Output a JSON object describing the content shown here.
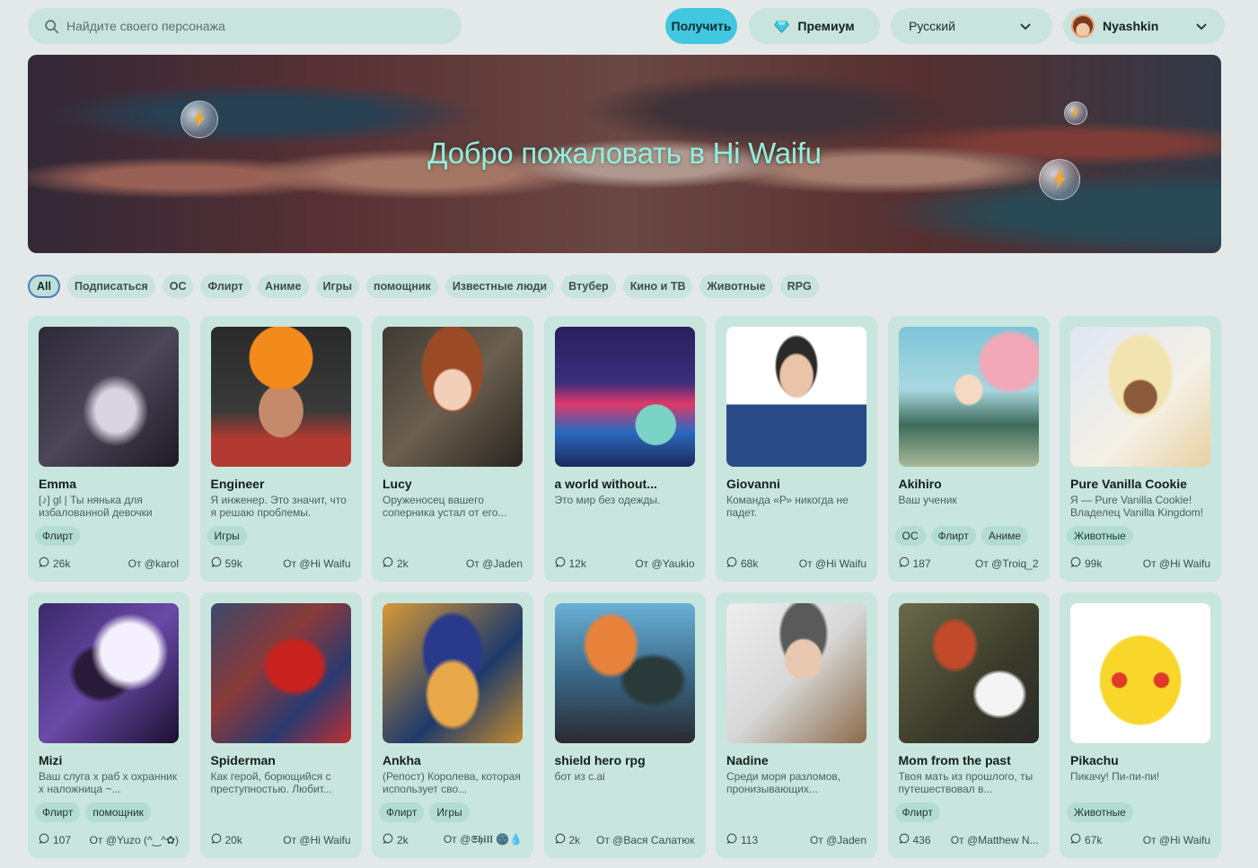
{
  "search": {
    "placeholder": "Найдите своего персонажа"
  },
  "header": {
    "get_label": "Получить",
    "premium_label": "Премиум",
    "language": "Русский",
    "username": "Nyashkin"
  },
  "banner": {
    "title": "Добро пожаловать в Hi Waifu"
  },
  "filters": [
    "All",
    "Подписаться",
    "OC",
    "Флирт",
    "Аниме",
    "Игры",
    "помощник",
    "Известные люди",
    "Втубер",
    "Кино и ТВ",
    "Животные",
    "RPG"
  ],
  "colors": {
    "accent": "#3fc8e0",
    "card": "#c8e6dd",
    "chip": "#c9e4dc",
    "title": "#8ff0dc"
  },
  "cards": [
    {
      "name": "Emma",
      "desc": "[♪] gl | Ты нянька для избалованной девочки",
      "tags": [
        "Флирт"
      ],
      "count": "26k",
      "author": "От @karol",
      "icon": "girl-phone-image"
    },
    {
      "name": "Engineer",
      "desc": "Я инженер. Это значит, что я решаю проблемы.",
      "tags": [
        "Игры"
      ],
      "count": "59k",
      "author": "От @Hi Waifu",
      "icon": "engineer-image"
    },
    {
      "name": "Lucy",
      "desc": "Оруженосец вашего соперника устал от его...",
      "tags": [],
      "count": "2k",
      "author": "От @Jaden",
      "icon": "lucy-image"
    },
    {
      "name": "a world without...",
      "desc": "Это мир без одежды.",
      "tags": [],
      "count": "12k",
      "author": "От @Yaukio",
      "icon": "un-mundo-image"
    },
    {
      "name": "Giovanni",
      "desc": "Команда «Р» никогда не падет.",
      "tags": [],
      "count": "68k",
      "author": "От @Hi Waifu",
      "icon": "giovanni-image"
    },
    {
      "name": "Akihiro",
      "desc": "Ваш ученик",
      "tags": [
        "OC",
        "Флирт",
        "Аниме"
      ],
      "count": "187",
      "author": "От @Troiq_2",
      "icon": "akihiro-image"
    },
    {
      "name": "Pure Vanilla Cookie",
      "desc": "Я — Pure Vanilla Cookie! Владелец Vanilla Kingdom!",
      "tags": [
        "Животные"
      ],
      "count": "99k",
      "author": "От @Hi Waifu",
      "icon": "vanilla-cookie-image"
    },
    {
      "name": "Mizi",
      "desc": "Ваш слуга x раб x охранник x наложница ~...",
      "tags": [
        "Флирт",
        "помощник"
      ],
      "count": "107",
      "author": "От @Yuzo (^‿^✿)",
      "icon": "mizi-image"
    },
    {
      "name": "Spiderman",
      "desc": "Как герой, борющийся с преступностью. Любит...",
      "tags": [],
      "count": "20k",
      "author": "От @Hi Waifu",
      "icon": "spiderman-image"
    },
    {
      "name": "Ankha",
      "desc": "(Репост) Королева, которая использует сво...",
      "tags": [
        "Флирт",
        "Игры"
      ],
      "count": "2k",
      "author": "От @𝕾𝖍𝖎𝖑𝖑 🌚💧",
      "icon": "ankha-image"
    },
    {
      "name": "shield hero rpg",
      "desc": "бот из c.ai",
      "tags": [],
      "count": "2k",
      "author": "От @Вася Салатюк",
      "icon": "shield-hero-image"
    },
    {
      "name": "Nadine",
      "desc": "Среди моря разломов, пронизывающих...",
      "tags": [],
      "count": "113",
      "author": "От @Jaden",
      "icon": "nadine-image"
    },
    {
      "name": "Mom from the past",
      "desc": "Твоя мать из прошлого, ты путешествовал в...",
      "tags": [
        "Флирт"
      ],
      "count": "436",
      "author": "От @Matthew N...",
      "icon": "mom-past-image"
    },
    {
      "name": "Pikachu",
      "desc": "Пикачу! Пи-пи-пи!",
      "tags": [
        "Животные"
      ],
      "count": "67k",
      "author": "От @Hi Waifu",
      "icon": "pikachu-image"
    }
  ]
}
